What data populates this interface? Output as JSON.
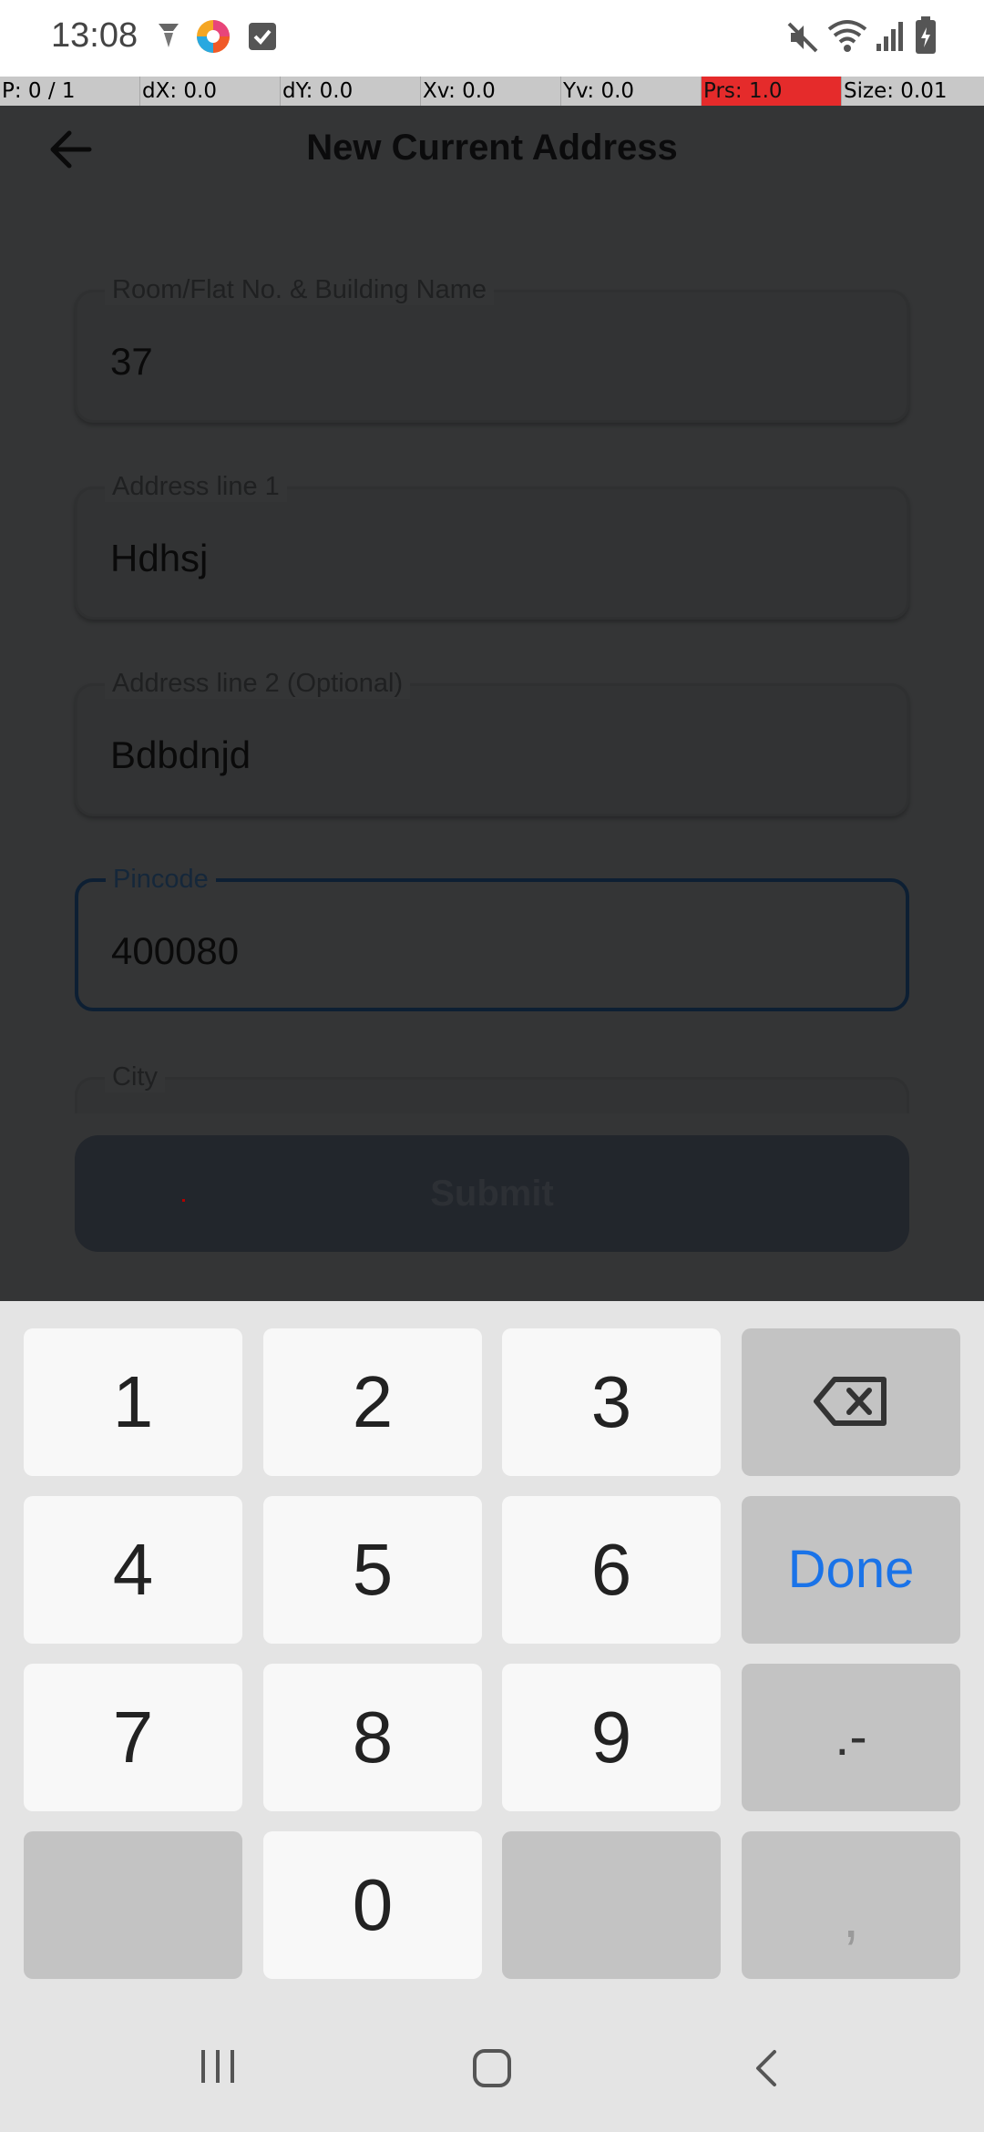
{
  "status_bar": {
    "time": "13:08",
    "icons": [
      "drone-icon",
      "color-wheel-icon",
      "checkbox-icon",
      "mute-icon",
      "wifi-icon",
      "signal-icon",
      "battery-icon"
    ]
  },
  "pointer_bar": {
    "p": "P: 0 / 1",
    "dx": "dX: 0.0",
    "dy": "dY: 0.0",
    "xv": "Xv: 0.0",
    "yv": "Yv: 0.0",
    "prs": "Prs: 1.0",
    "size": "Size: 0.01"
  },
  "header": {
    "title": "New Current Address"
  },
  "form": {
    "building": {
      "label": "Room/Flat No. & Building Name",
      "value": "37"
    },
    "address1": {
      "label": "Address line 1",
      "value": "Hdhsj"
    },
    "address2": {
      "label": "Address line 2 (Optional)",
      "value": "Bdbdnjd"
    },
    "pincode": {
      "label": "Pincode",
      "value": "400080"
    },
    "city": {
      "label": "City",
      "value": ""
    },
    "submit_label": "Submit"
  },
  "keyboard": {
    "keys": [
      "1",
      "2",
      "3",
      "4",
      "5",
      "6",
      "Done",
      "7",
      "8",
      "9",
      ".-",
      "0",
      ","
    ]
  },
  "colors": {
    "done_accent": "#1a73e8",
    "pointer_highlight": "#e52b2b",
    "dim_overlay": "#343536"
  }
}
